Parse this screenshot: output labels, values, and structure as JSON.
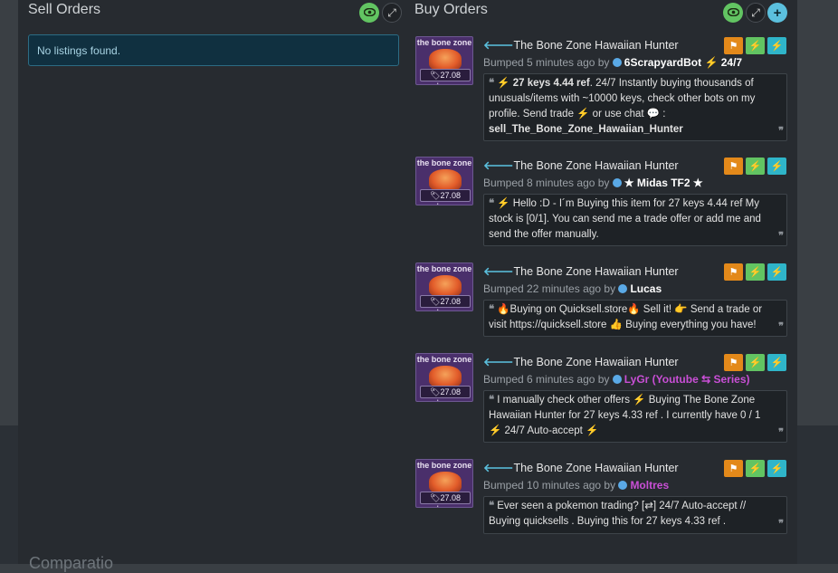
{
  "sell": {
    "title": "Sell Orders",
    "empty_text": "No listings found."
  },
  "buy": {
    "title": "Buy Orders"
  },
  "bottom_heading": "Comparatio",
  "listings": [
    {
      "thumb_label": "the bone zone",
      "price_badge": "27.08 keys",
      "title": "The Bone Zone Hawaiian Hunter",
      "bumped": "Bumped 5 minutes ago by",
      "user": "6ScrapyardBot ⚡ 24/7",
      "user_color": "#ffffff",
      "desc_parts": [
        "⚡ 27 keys 4.44 ref",
        ". 24/7 Instantly buying thousands of unusuals/items with ~10000 keys, check other bots on my profile. Send  trade ⚡ or  use  chat 💬 :",
        "sell_The_Bone_Zone_Hawaiian_Hunter"
      ]
    },
    {
      "thumb_label": "the bone zone",
      "price_badge": "27.08 keys",
      "title": "The Bone Zone Hawaiian Hunter",
      "bumped": "Bumped 8 minutes ago by",
      "user": "★ Midas TF2 ★",
      "user_color": "#ffffff",
      "desc": "⚡ Hello :D - I´m Buying this item for 27 keys 4.44 ref My stock is [0/1]. You can send me a trade offer or add me and send the offer manually."
    },
    {
      "thumb_label": "the bone zone",
      "price_badge": "27.08 keys",
      "title": "The Bone Zone Hawaiian Hunter",
      "bumped": "Bumped 22 minutes ago by",
      "user": "Lucas",
      "user_color": "#ffffff",
      "desc": "🔥Buying on Quicksell.store🔥 Sell it! 👉 Send a trade or visit https://quicksell.store 👍 Buying everything you have!"
    },
    {
      "thumb_label": "the bone zone",
      "price_badge": "27.08 keys",
      "title": "The Bone Zone Hawaiian Hunter",
      "bumped": "Bumped 6 minutes ago by",
      "user": "LyGr (Youtube ⇆ Series)",
      "user_color": "#c94fd6",
      "desc": "I manually check other offers ⚡ Buying The Bone Zone Hawaiian Hunter for 27 keys 4.33 ref . I currently have 0 / 1 ⚡ 24/7 Auto-accept ⚡"
    },
    {
      "thumb_label": "the bone zone",
      "price_badge": "27.08 keys",
      "title": "The Bone Zone Hawaiian Hunter",
      "bumped": "Bumped 10 minutes ago by",
      "user": "Moltres",
      "user_color": "#c94fd6",
      "desc": "Ever seen a pokemon trading? [⇄] 24/7 Auto-accept // Buying quicksells . Buying this for 27 keys 4.33 ref ."
    }
  ]
}
